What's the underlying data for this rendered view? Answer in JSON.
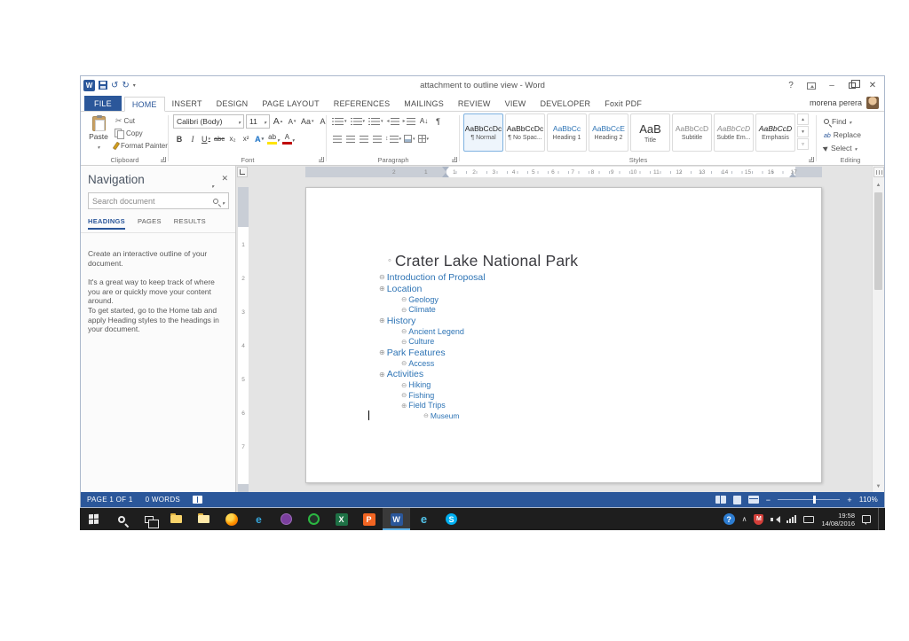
{
  "titlebar": {
    "title": "attachment to outline view - Word"
  },
  "account": {
    "user": "morena perera"
  },
  "ribbon_tabs": [
    "FILE",
    "HOME",
    "INSERT",
    "DESIGN",
    "PAGE LAYOUT",
    "REFERENCES",
    "MAILINGS",
    "REVIEW",
    "VIEW",
    "DEVELOPER",
    "Foxit PDF"
  ],
  "clipboard": {
    "group": "Clipboard",
    "paste": "Paste",
    "cut": "Cut",
    "copy": "Copy",
    "format_painter": "Format Painter"
  },
  "font": {
    "group": "Font",
    "name": "Calibri (Body)",
    "size": "11",
    "bold": "B",
    "italic": "I",
    "underline": "U",
    "strikethrough": "abc",
    "subscript": "x₂",
    "superscript": "x²",
    "effects": "A",
    "highlight": "ab",
    "color": "A",
    "grow": "A",
    "shrink": "A",
    "case": "Aa",
    "clear": "A"
  },
  "paragraph": {
    "group": "Paragraph",
    "sort": "A↓",
    "pilcrow": "¶"
  },
  "styles": {
    "group": "Styles",
    "items": [
      {
        "preview": "AaBbCcDc",
        "name": "¶ Normal"
      },
      {
        "preview": "AaBbCcDc",
        "name": "¶ No Spac..."
      },
      {
        "preview": "AaBbCc",
        "name": "Heading 1"
      },
      {
        "preview": "AaBbCcE",
        "name": "Heading 2"
      },
      {
        "preview": "AaB",
        "name": "Title"
      },
      {
        "preview": "AaBbCcD",
        "name": "Subtitle"
      },
      {
        "preview": "AaBbCcD",
        "name": "Subtle Em..."
      },
      {
        "preview": "AaBbCcD",
        "name": "Emphasis"
      }
    ]
  },
  "editing": {
    "group": "Editing",
    "find": "Find",
    "replace": "Replace",
    "select": "Select"
  },
  "nav": {
    "title": "Navigation",
    "search_placeholder": "Search document",
    "tabs": [
      "HEADINGS",
      "PAGES",
      "RESULTS"
    ],
    "body": [
      "Create an interactive outline of your document.",
      "It's a great way to keep track of where you are or quickly move your content around.",
      "To get started, go to the Home tab and apply Heading styles to the headings in your document."
    ]
  },
  "ruler": {
    "left": [
      "2",
      "1"
    ],
    "main": [
      "1",
      "2",
      "3",
      "4",
      "5",
      "6",
      "7",
      "8",
      "9",
      "10",
      "11",
      "12",
      "13",
      "14",
      "15",
      "16",
      "17"
    ],
    "vertical": [
      "1",
      "2",
      "3",
      "4",
      "5",
      "6",
      "7"
    ]
  },
  "doc": {
    "title_bullet": "◦",
    "title": "Crater Lake National Park",
    "outline": [
      {
        "s": "⊖",
        "t": "Introduction of Proposal"
      },
      {
        "s": "⊕",
        "t": "Location"
      },
      {
        "s": "⊖",
        "t": "Geology"
      },
      {
        "s": "⊖",
        "t": "Climate"
      },
      {
        "s": "⊕",
        "t": "History"
      },
      {
        "s": "⊖",
        "t": "Ancient Legend"
      },
      {
        "s": "⊖",
        "t": "Culture"
      },
      {
        "s": "⊕",
        "t": "Park Features"
      },
      {
        "s": "⊖",
        "t": "Access"
      },
      {
        "s": "⊕",
        "t": "Activities"
      },
      {
        "s": "⊖",
        "t": "Hiking"
      },
      {
        "s": "⊖",
        "t": "Fishing"
      },
      {
        "s": "⊕",
        "t": "Field Trips"
      },
      {
        "s": "⊖",
        "t": "Museum"
      }
    ]
  },
  "status": {
    "page": "PAGE 1 OF 1",
    "words": "0 WORDS",
    "zoom": "110%"
  },
  "taskbar": {
    "time": "19:58",
    "date": "14/08/2016",
    "glyphs": {
      "edge": "e",
      "excel": "X",
      "pdf": "P",
      "word": "W",
      "ie": "e",
      "skype": "S",
      "help": "?"
    }
  }
}
